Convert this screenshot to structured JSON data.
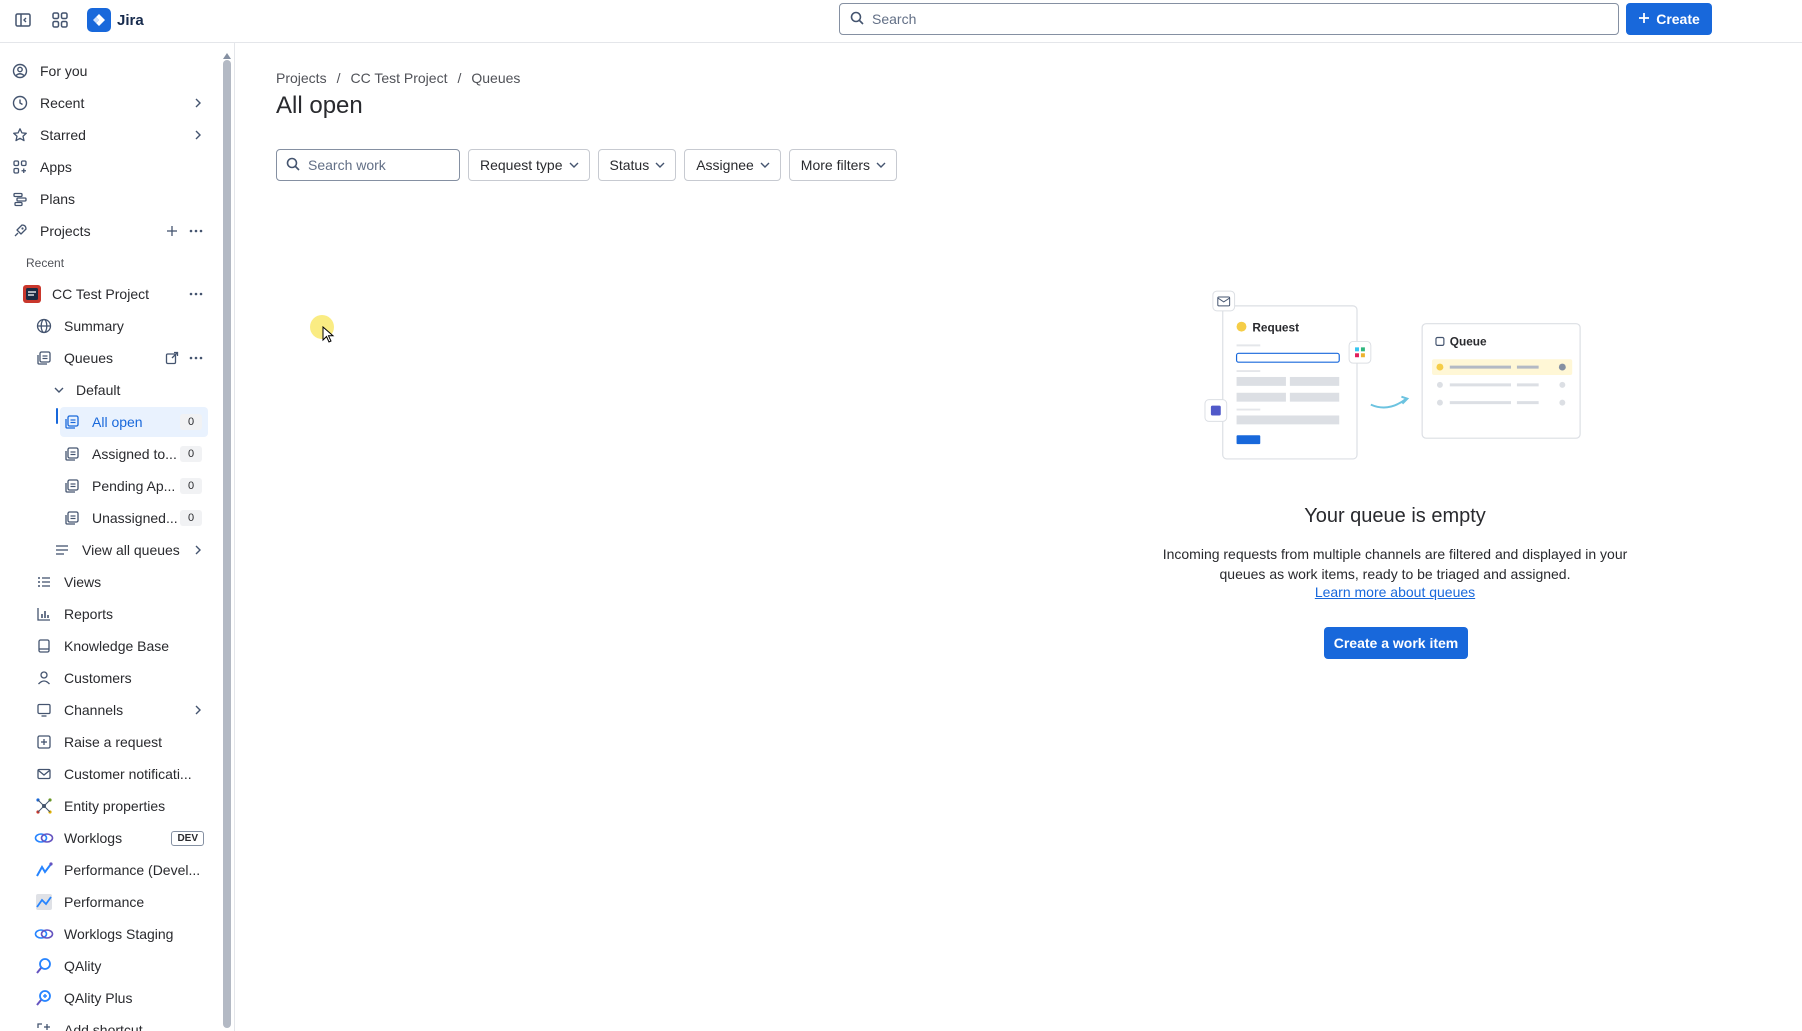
{
  "topbar": {
    "app_name": "Jira",
    "search_placeholder": "Search",
    "create_label": "Create"
  },
  "sidebar": {
    "for_you": "For you",
    "recent": "Recent",
    "starred": "Starred",
    "apps": "Apps",
    "plans": "Plans",
    "projects": "Projects",
    "recent_section": "Recent",
    "project_name": "CC Test Project",
    "summary": "Summary",
    "queues": "Queues",
    "default_group": "Default",
    "queue_items": [
      {
        "label": "All open",
        "count": "0"
      },
      {
        "label": "Assigned to...",
        "count": "0"
      },
      {
        "label": "Pending Ap...",
        "count": "0"
      },
      {
        "label": "Unassigned...",
        "count": "0"
      }
    ],
    "view_all_queues": "View all queues",
    "views": "Views",
    "reports": "Reports",
    "knowledge_base": "Knowledge Base",
    "customers": "Customers",
    "channels": "Channels",
    "raise_request": "Raise a request",
    "customer_notifications": "Customer notificati...",
    "entity_properties": "Entity properties",
    "worklogs": "Worklogs",
    "worklogs_badge": "DEV",
    "performance_dev": "Performance (Devel...",
    "performance": "Performance",
    "worklogs_staging": "Worklogs Staging",
    "qality": "QAlity",
    "qality_plus": "QAlity Plus",
    "add_shortcut": "Add shortcut"
  },
  "main": {
    "breadcrumb": [
      "Projects",
      "CC Test Project",
      "Queues"
    ],
    "title": "All open",
    "search_work_placeholder": "Search work",
    "filters": [
      "Request type",
      "Status",
      "Assignee",
      "More filters"
    ]
  },
  "empty_state": {
    "card_request": "Request",
    "card_queue": "Queue",
    "title": "Your queue is empty",
    "description": "Incoming requests from multiple channels are filtered and displayed in your queues as work items, ready to be triaged and assigned.",
    "link": "Learn more about queues",
    "button": "Create a work item"
  },
  "colors": {
    "brand": "#1868db",
    "text": "#292a2e",
    "subtle": "#505258",
    "active_bg": "#e9f2fe"
  }
}
